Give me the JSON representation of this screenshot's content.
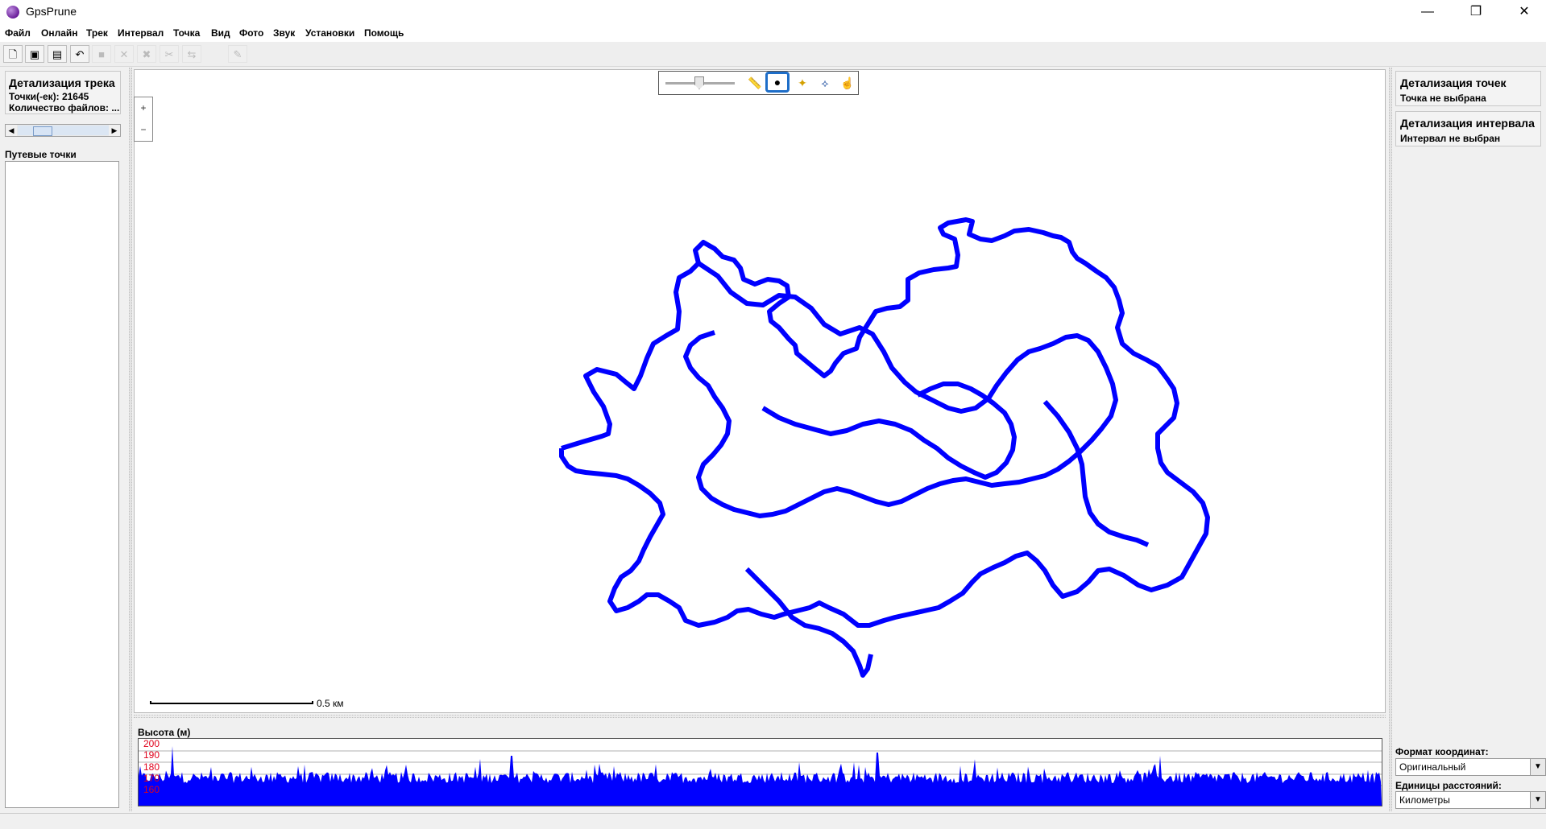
{
  "window": {
    "title": "GpsPrune",
    "minimize": "—",
    "restore": "❐",
    "close": "✕"
  },
  "menu": [
    "Файл",
    "Онлайн",
    "Трек",
    "Интервал",
    "Точка",
    "Вид",
    "Фото",
    "Звук",
    "Установки",
    "Помощь"
  ],
  "toolbar": {
    "icons": [
      "new-file-icon",
      "add-photo-icon",
      "save-icon",
      "undo-icon",
      "stop-icon",
      "delete-icon",
      "delete-range-icon",
      "crop-icon",
      "reverse-icon",
      "edit-icon"
    ]
  },
  "left": {
    "track_title": "Детализация трека",
    "points_line": "Точки(-ек): 21645",
    "files_line": "Количество файлов: ...",
    "waypoints_label": "Путевые точки"
  },
  "map": {
    "zoom_in": "+",
    "zoom_out": "−",
    "scale_label": "0.5 км",
    "controls": [
      "ruler-icon",
      "globe-icon",
      "waypoint-icon",
      "route-icon",
      "hand-icon"
    ],
    "active_control": "globe-icon",
    "track_color": "#0000ff"
  },
  "profile": {
    "label": "Высота (м)",
    "y_ticks": [
      "200",
      "190",
      "180",
      "170",
      "160"
    ],
    "fill_color": "#0000ff"
  },
  "right": {
    "point_title": "Детализация точек",
    "point_sub": "Точка не выбрана",
    "range_title": "Детализация интервала",
    "range_sub": "Интервал не выбран",
    "coord_label": "Формат координат:",
    "coord_value": "Оригинальный",
    "units_label": "Единицы расстояний:",
    "units_value": "Километры"
  }
}
